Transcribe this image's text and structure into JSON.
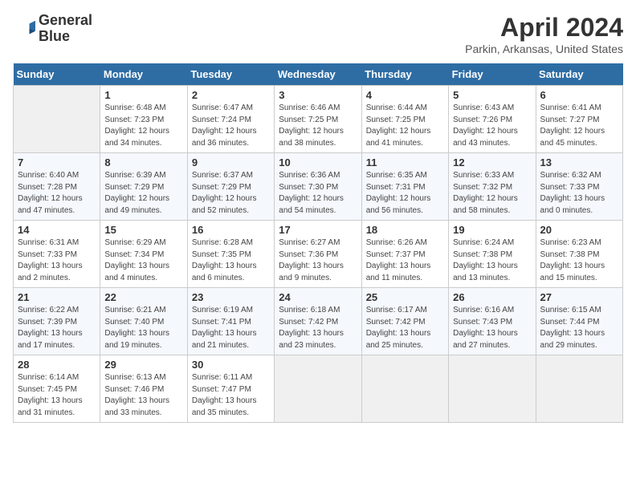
{
  "header": {
    "logo_line1": "General",
    "logo_line2": "Blue",
    "month_title": "April 2024",
    "location": "Parkin, Arkansas, United States"
  },
  "weekdays": [
    "Sunday",
    "Monday",
    "Tuesday",
    "Wednesday",
    "Thursday",
    "Friday",
    "Saturday"
  ],
  "weeks": [
    [
      {
        "num": "",
        "info": ""
      },
      {
        "num": "1",
        "info": "Sunrise: 6:48 AM\nSunset: 7:23 PM\nDaylight: 12 hours\nand 34 minutes."
      },
      {
        "num": "2",
        "info": "Sunrise: 6:47 AM\nSunset: 7:24 PM\nDaylight: 12 hours\nand 36 minutes."
      },
      {
        "num": "3",
        "info": "Sunrise: 6:46 AM\nSunset: 7:25 PM\nDaylight: 12 hours\nand 38 minutes."
      },
      {
        "num": "4",
        "info": "Sunrise: 6:44 AM\nSunset: 7:25 PM\nDaylight: 12 hours\nand 41 minutes."
      },
      {
        "num": "5",
        "info": "Sunrise: 6:43 AM\nSunset: 7:26 PM\nDaylight: 12 hours\nand 43 minutes."
      },
      {
        "num": "6",
        "info": "Sunrise: 6:41 AM\nSunset: 7:27 PM\nDaylight: 12 hours\nand 45 minutes."
      }
    ],
    [
      {
        "num": "7",
        "info": "Sunrise: 6:40 AM\nSunset: 7:28 PM\nDaylight: 12 hours\nand 47 minutes."
      },
      {
        "num": "8",
        "info": "Sunrise: 6:39 AM\nSunset: 7:29 PM\nDaylight: 12 hours\nand 49 minutes."
      },
      {
        "num": "9",
        "info": "Sunrise: 6:37 AM\nSunset: 7:29 PM\nDaylight: 12 hours\nand 52 minutes."
      },
      {
        "num": "10",
        "info": "Sunrise: 6:36 AM\nSunset: 7:30 PM\nDaylight: 12 hours\nand 54 minutes."
      },
      {
        "num": "11",
        "info": "Sunrise: 6:35 AM\nSunset: 7:31 PM\nDaylight: 12 hours\nand 56 minutes."
      },
      {
        "num": "12",
        "info": "Sunrise: 6:33 AM\nSunset: 7:32 PM\nDaylight: 12 hours\nand 58 minutes."
      },
      {
        "num": "13",
        "info": "Sunrise: 6:32 AM\nSunset: 7:33 PM\nDaylight: 13 hours\nand 0 minutes."
      }
    ],
    [
      {
        "num": "14",
        "info": "Sunrise: 6:31 AM\nSunset: 7:33 PM\nDaylight: 13 hours\nand 2 minutes."
      },
      {
        "num": "15",
        "info": "Sunrise: 6:29 AM\nSunset: 7:34 PM\nDaylight: 13 hours\nand 4 minutes."
      },
      {
        "num": "16",
        "info": "Sunrise: 6:28 AM\nSunset: 7:35 PM\nDaylight: 13 hours\nand 6 minutes."
      },
      {
        "num": "17",
        "info": "Sunrise: 6:27 AM\nSunset: 7:36 PM\nDaylight: 13 hours\nand 9 minutes."
      },
      {
        "num": "18",
        "info": "Sunrise: 6:26 AM\nSunset: 7:37 PM\nDaylight: 13 hours\nand 11 minutes."
      },
      {
        "num": "19",
        "info": "Sunrise: 6:24 AM\nSunset: 7:38 PM\nDaylight: 13 hours\nand 13 minutes."
      },
      {
        "num": "20",
        "info": "Sunrise: 6:23 AM\nSunset: 7:38 PM\nDaylight: 13 hours\nand 15 minutes."
      }
    ],
    [
      {
        "num": "21",
        "info": "Sunrise: 6:22 AM\nSunset: 7:39 PM\nDaylight: 13 hours\nand 17 minutes."
      },
      {
        "num": "22",
        "info": "Sunrise: 6:21 AM\nSunset: 7:40 PM\nDaylight: 13 hours\nand 19 minutes."
      },
      {
        "num": "23",
        "info": "Sunrise: 6:19 AM\nSunset: 7:41 PM\nDaylight: 13 hours\nand 21 minutes."
      },
      {
        "num": "24",
        "info": "Sunrise: 6:18 AM\nSunset: 7:42 PM\nDaylight: 13 hours\nand 23 minutes."
      },
      {
        "num": "25",
        "info": "Sunrise: 6:17 AM\nSunset: 7:42 PM\nDaylight: 13 hours\nand 25 minutes."
      },
      {
        "num": "26",
        "info": "Sunrise: 6:16 AM\nSunset: 7:43 PM\nDaylight: 13 hours\nand 27 minutes."
      },
      {
        "num": "27",
        "info": "Sunrise: 6:15 AM\nSunset: 7:44 PM\nDaylight: 13 hours\nand 29 minutes."
      }
    ],
    [
      {
        "num": "28",
        "info": "Sunrise: 6:14 AM\nSunset: 7:45 PM\nDaylight: 13 hours\nand 31 minutes."
      },
      {
        "num": "29",
        "info": "Sunrise: 6:13 AM\nSunset: 7:46 PM\nDaylight: 13 hours\nand 33 minutes."
      },
      {
        "num": "30",
        "info": "Sunrise: 6:11 AM\nSunset: 7:47 PM\nDaylight: 13 hours\nand 35 minutes."
      },
      {
        "num": "",
        "info": ""
      },
      {
        "num": "",
        "info": ""
      },
      {
        "num": "",
        "info": ""
      },
      {
        "num": "",
        "info": ""
      }
    ]
  ]
}
